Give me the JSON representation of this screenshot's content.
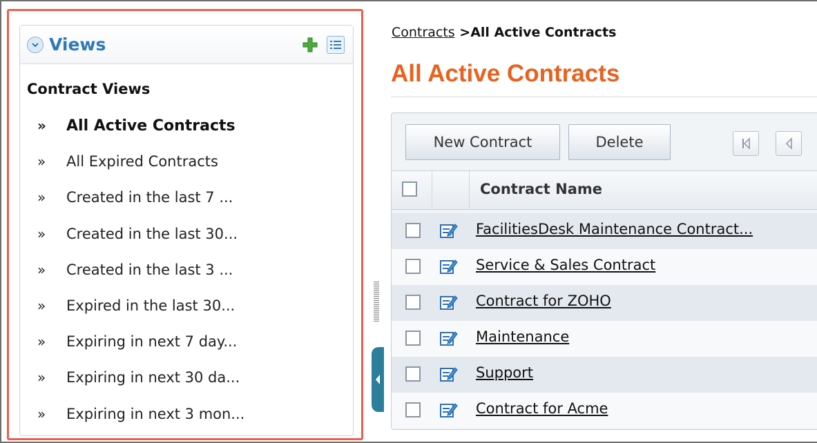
{
  "views_panel": {
    "title": "Views",
    "section_title": "Contract Views",
    "items": [
      {
        "label": "All Active Contracts",
        "active": true
      },
      {
        "label": "All Expired Contracts",
        "active": false
      },
      {
        "label": "Created in the last 7 ...",
        "active": false
      },
      {
        "label": "Created in the last 30...",
        "active": false
      },
      {
        "label": "Created in the last 3 ...",
        "active": false
      },
      {
        "label": "Expired in the last 30...",
        "active": false
      },
      {
        "label": "Expiring in next 7 day...",
        "active": false
      },
      {
        "label": "Expiring in next 30 da...",
        "active": false
      },
      {
        "label": "Expiring in next 3 mon...",
        "active": false
      }
    ],
    "bullet": "»"
  },
  "breadcrumb": {
    "root": "Contracts",
    "separator": " >",
    "current": "All Active Contracts"
  },
  "page_title": "All Active Contracts",
  "toolbar": {
    "new_label": "New Contract",
    "delete_label": "Delete"
  },
  "table": {
    "column_header": "Contract Name",
    "rows": [
      "FacilitiesDesk Maintenance Contract...",
      "Service & Sales Contract",
      "Contract for ZOHO",
      "Maintenance",
      "Support",
      "Contract for Acme"
    ]
  },
  "colors": {
    "highlight_border": "#e8604b",
    "title_orange": "#e8621e",
    "views_blue": "#2f79b8",
    "handle_teal": "#2b7f9b"
  }
}
